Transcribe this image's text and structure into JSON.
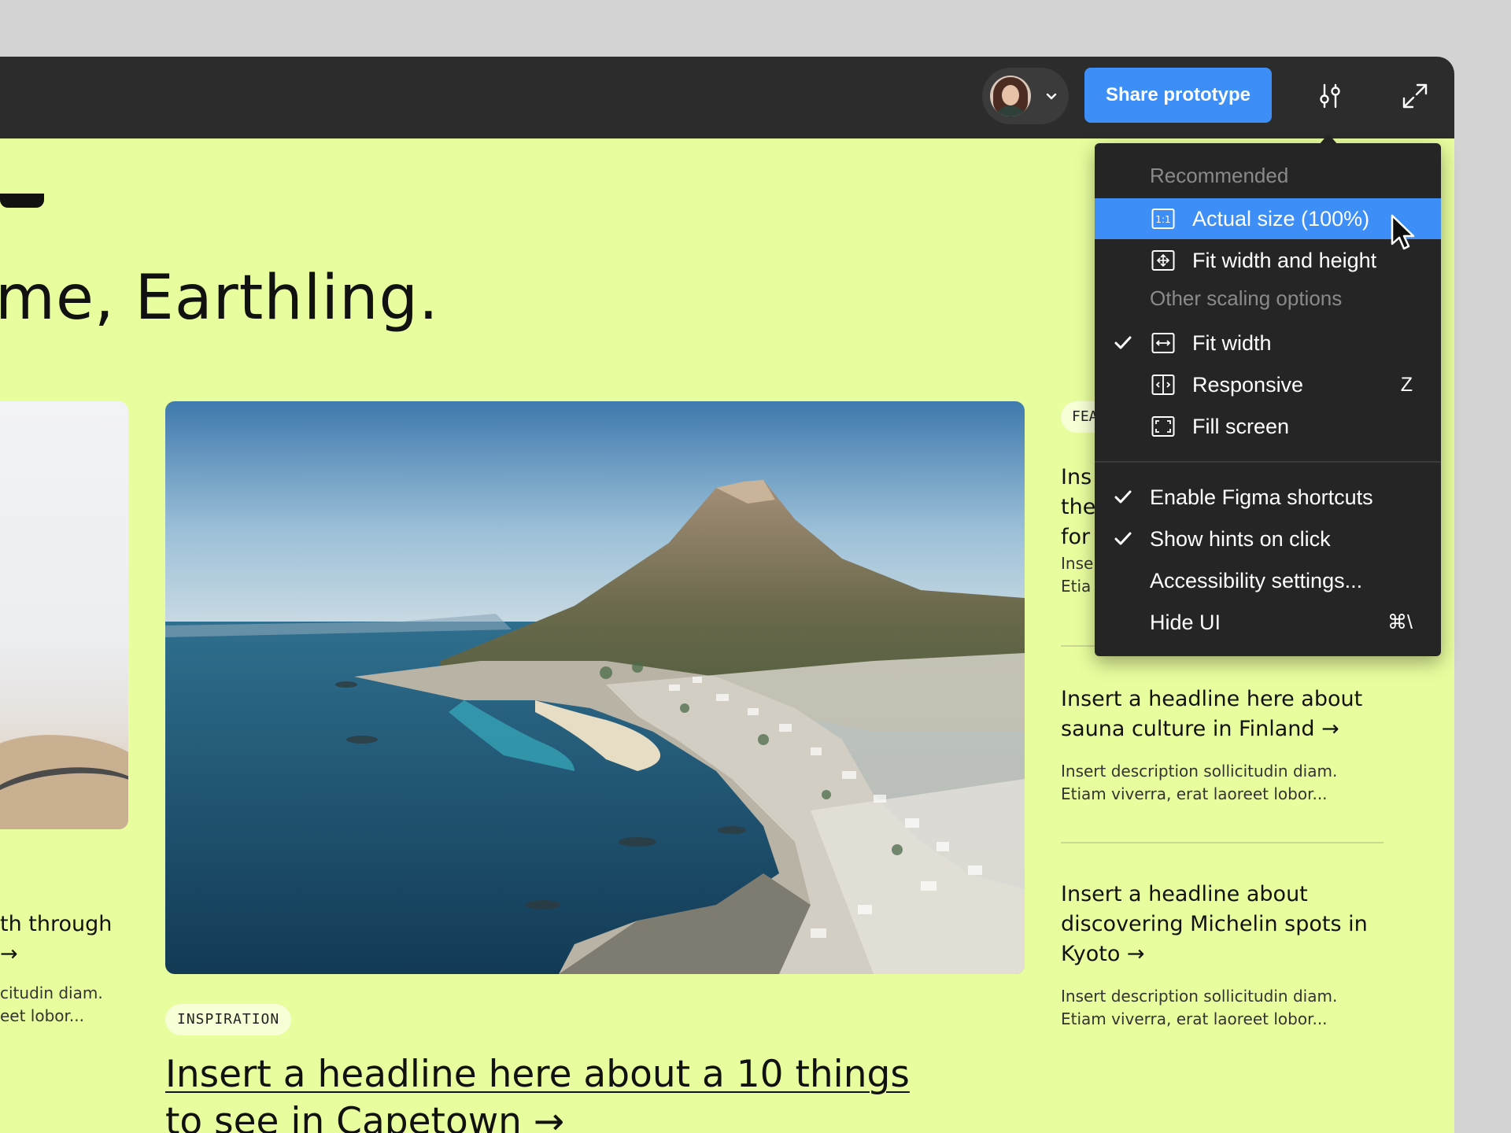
{
  "toolbar": {
    "share_label": "Share prototype"
  },
  "page": {
    "heading": "me, Earthling.",
    "left_article": {
      "headline_lines": [
        "th through",
        "→"
      ],
      "desc_lines": [
        "citudin diam.",
        "eet lobor..."
      ]
    },
    "main_article": {
      "tag": "INSPIRATION",
      "headline_lines": [
        "Insert a headline here about a 10 things",
        "to see in Capetown →"
      ]
    },
    "sidebar": {
      "featured_tag": "FEA",
      "partial_headline_lines": [
        "Ins",
        "the",
        "for"
      ],
      "partial_desc_lines": [
        "Inse",
        "Etia"
      ],
      "articles": [
        {
          "headline_lines": [
            "Insert a headline here about",
            "sauna culture in Finland →"
          ],
          "desc_lines": [
            "Insert description sollicitudin diam.",
            "Etiam viverra, erat laoreet lobor..."
          ]
        },
        {
          "headline_lines": [
            "Insert a headline about",
            "discovering Michelin spots in",
            "Kyoto →"
          ],
          "desc_lines": [
            "Insert description sollicitudin diam.",
            "Etiam viverra, erat laoreet lobor..."
          ]
        }
      ]
    }
  },
  "menu": {
    "section_recommended": "Recommended",
    "section_other": "Other scaling options",
    "items": [
      {
        "label": "Actual size (100%)",
        "icon": "actual-size-icon",
        "active": true
      },
      {
        "label": "Fit width and height",
        "icon": "fit-width-height-icon"
      },
      {
        "label": "Fit width",
        "icon": "fit-width-icon",
        "checked": true
      },
      {
        "label": "Responsive",
        "icon": "responsive-icon",
        "shortcut": "Z"
      },
      {
        "label": "Fill screen",
        "icon": "fill-screen-icon"
      }
    ],
    "options": [
      {
        "label": "Enable Figma shortcuts",
        "checked": true
      },
      {
        "label": "Show hints on click",
        "checked": true
      },
      {
        "label": "Accessibility settings..."
      },
      {
        "label": "Hide UI",
        "shortcut": "⌘\\"
      }
    ]
  },
  "colors": {
    "canvas_bg": "#e8fd9e",
    "toolbar_bg": "#2c2c2c",
    "accent": "#3d8ef6",
    "menu_bg": "#252525"
  }
}
